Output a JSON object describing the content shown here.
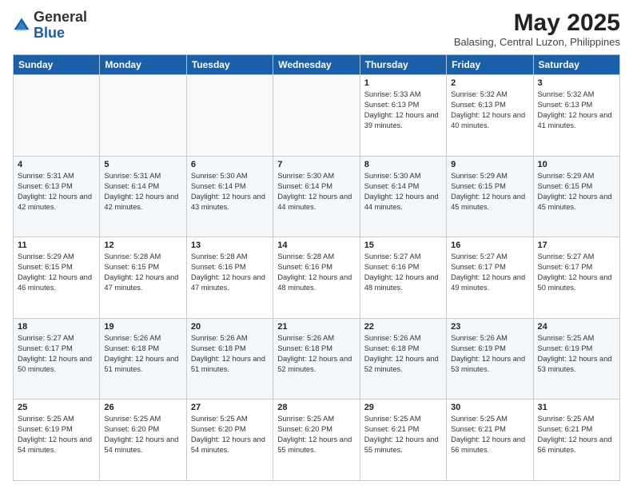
{
  "header": {
    "logo_general": "General",
    "logo_blue": "Blue",
    "month_year": "May 2025",
    "location": "Balasing, Central Luzon, Philippines"
  },
  "days_of_week": [
    "Sunday",
    "Monday",
    "Tuesday",
    "Wednesday",
    "Thursday",
    "Friday",
    "Saturday"
  ],
  "weeks": [
    [
      {
        "day": "",
        "sunrise": "",
        "sunset": "",
        "daylight": ""
      },
      {
        "day": "",
        "sunrise": "",
        "sunset": "",
        "daylight": ""
      },
      {
        "day": "",
        "sunrise": "",
        "sunset": "",
        "daylight": ""
      },
      {
        "day": "",
        "sunrise": "",
        "sunset": "",
        "daylight": ""
      },
      {
        "day": "1",
        "sunrise": "5:33 AM",
        "sunset": "6:13 PM",
        "daylight": "12 hours and 39 minutes."
      },
      {
        "day": "2",
        "sunrise": "5:32 AM",
        "sunset": "6:13 PM",
        "daylight": "12 hours and 40 minutes."
      },
      {
        "day": "3",
        "sunrise": "5:32 AM",
        "sunset": "6:13 PM",
        "daylight": "12 hours and 41 minutes."
      }
    ],
    [
      {
        "day": "4",
        "sunrise": "5:31 AM",
        "sunset": "6:13 PM",
        "daylight": "12 hours and 42 minutes."
      },
      {
        "day": "5",
        "sunrise": "5:31 AM",
        "sunset": "6:14 PM",
        "daylight": "12 hours and 42 minutes."
      },
      {
        "day": "6",
        "sunrise": "5:30 AM",
        "sunset": "6:14 PM",
        "daylight": "12 hours and 43 minutes."
      },
      {
        "day": "7",
        "sunrise": "5:30 AM",
        "sunset": "6:14 PM",
        "daylight": "12 hours and 44 minutes."
      },
      {
        "day": "8",
        "sunrise": "5:30 AM",
        "sunset": "6:14 PM",
        "daylight": "12 hours and 44 minutes."
      },
      {
        "day": "9",
        "sunrise": "5:29 AM",
        "sunset": "6:15 PM",
        "daylight": "12 hours and 45 minutes."
      },
      {
        "day": "10",
        "sunrise": "5:29 AM",
        "sunset": "6:15 PM",
        "daylight": "12 hours and 45 minutes."
      }
    ],
    [
      {
        "day": "11",
        "sunrise": "5:29 AM",
        "sunset": "6:15 PM",
        "daylight": "12 hours and 46 minutes."
      },
      {
        "day": "12",
        "sunrise": "5:28 AM",
        "sunset": "6:15 PM",
        "daylight": "12 hours and 47 minutes."
      },
      {
        "day": "13",
        "sunrise": "5:28 AM",
        "sunset": "6:16 PM",
        "daylight": "12 hours and 47 minutes."
      },
      {
        "day": "14",
        "sunrise": "5:28 AM",
        "sunset": "6:16 PM",
        "daylight": "12 hours and 48 minutes."
      },
      {
        "day": "15",
        "sunrise": "5:27 AM",
        "sunset": "6:16 PM",
        "daylight": "12 hours and 48 minutes."
      },
      {
        "day": "16",
        "sunrise": "5:27 AM",
        "sunset": "6:17 PM",
        "daylight": "12 hours and 49 minutes."
      },
      {
        "day": "17",
        "sunrise": "5:27 AM",
        "sunset": "6:17 PM",
        "daylight": "12 hours and 50 minutes."
      }
    ],
    [
      {
        "day": "18",
        "sunrise": "5:27 AM",
        "sunset": "6:17 PM",
        "daylight": "12 hours and 50 minutes."
      },
      {
        "day": "19",
        "sunrise": "5:26 AM",
        "sunset": "6:18 PM",
        "daylight": "12 hours and 51 minutes."
      },
      {
        "day": "20",
        "sunrise": "5:26 AM",
        "sunset": "6:18 PM",
        "daylight": "12 hours and 51 minutes."
      },
      {
        "day": "21",
        "sunrise": "5:26 AM",
        "sunset": "6:18 PM",
        "daylight": "12 hours and 52 minutes."
      },
      {
        "day": "22",
        "sunrise": "5:26 AM",
        "sunset": "6:18 PM",
        "daylight": "12 hours and 52 minutes."
      },
      {
        "day": "23",
        "sunrise": "5:26 AM",
        "sunset": "6:19 PM",
        "daylight": "12 hours and 53 minutes."
      },
      {
        "day": "24",
        "sunrise": "5:25 AM",
        "sunset": "6:19 PM",
        "daylight": "12 hours and 53 minutes."
      }
    ],
    [
      {
        "day": "25",
        "sunrise": "5:25 AM",
        "sunset": "6:19 PM",
        "daylight": "12 hours and 54 minutes."
      },
      {
        "day": "26",
        "sunrise": "5:25 AM",
        "sunset": "6:20 PM",
        "daylight": "12 hours and 54 minutes."
      },
      {
        "day": "27",
        "sunrise": "5:25 AM",
        "sunset": "6:20 PM",
        "daylight": "12 hours and 54 minutes."
      },
      {
        "day": "28",
        "sunrise": "5:25 AM",
        "sunset": "6:20 PM",
        "daylight": "12 hours and 55 minutes."
      },
      {
        "day": "29",
        "sunrise": "5:25 AM",
        "sunset": "6:21 PM",
        "daylight": "12 hours and 55 minutes."
      },
      {
        "day": "30",
        "sunrise": "5:25 AM",
        "sunset": "6:21 PM",
        "daylight": "12 hours and 56 minutes."
      },
      {
        "day": "31",
        "sunrise": "5:25 AM",
        "sunset": "6:21 PM",
        "daylight": "12 hours and 56 minutes."
      }
    ]
  ]
}
